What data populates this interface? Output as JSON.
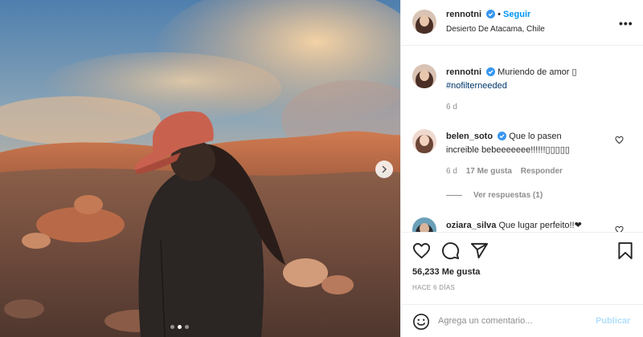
{
  "header": {
    "username": "rennotni",
    "follow_label": "Seguir",
    "location": "Desierto De Atacama, Chile",
    "more_label": "•••"
  },
  "caption": {
    "username": "rennotni",
    "text": "Muriendo de amor ▯",
    "hashtag": "#nofilterneeded",
    "time": "6 d"
  },
  "comments": [
    {
      "username": "belen_soto",
      "text_line1": "Que lo pasen",
      "text_line2": "increible bebeeeeeee!!!!!!▯▯▯▯▯",
      "time": "6 d",
      "likes": "17 Me gusta",
      "reply_label": "Responder",
      "view_replies": "Ver respuestas (1)"
    },
    {
      "username": "oziara_silva",
      "text": "Que lugar perfeito!!❤"
    }
  ],
  "actions": {
    "likes_count": "56,233 Me gusta",
    "time_ago": "HACE 6 DÍAS"
  },
  "add_comment": {
    "placeholder": "Agrega un comentario...",
    "publish_label": "Publicar"
  },
  "carousel": {
    "total_slides": 3,
    "active_slide": 2
  },
  "colors": {
    "link_blue": "#0095f6",
    "verified_blue": "#3897f0",
    "hashtag_blue": "#00376b",
    "muted_gray": "#8e8e8e",
    "publish_disabled": "#b2dffc"
  },
  "icons": [
    "verified-badge-icon",
    "heart-icon",
    "comment-icon",
    "share-icon",
    "bookmark-icon",
    "emoji-icon",
    "chevron-right-icon",
    "more-options-icon"
  ]
}
